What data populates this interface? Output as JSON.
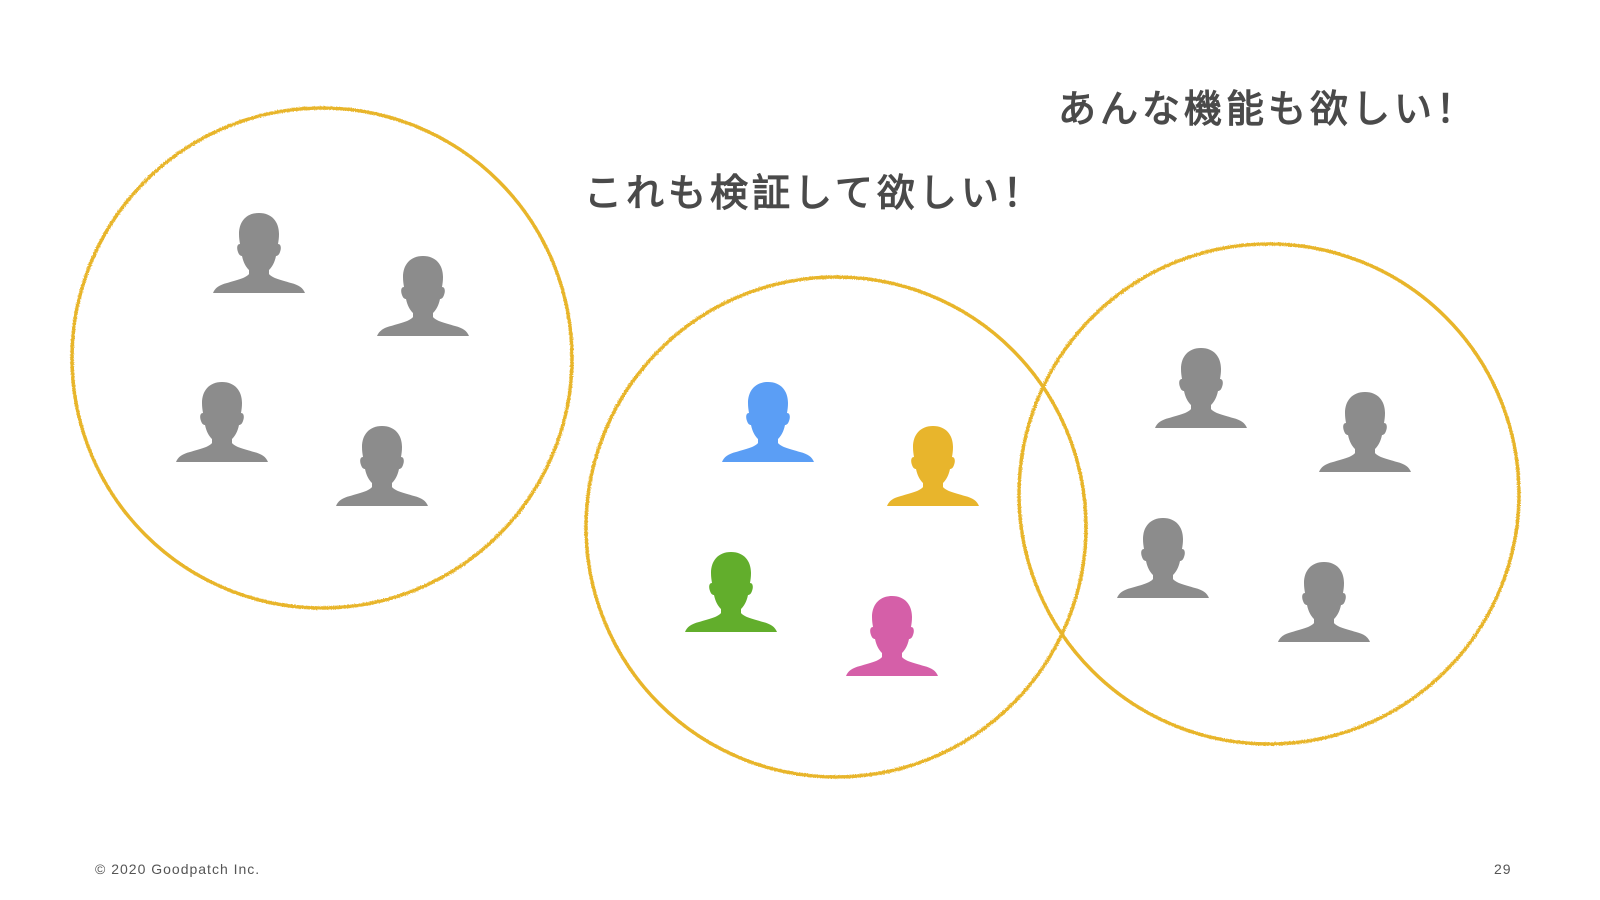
{
  "callouts": {
    "right": "あんな機能も欲しい！",
    "middle": "これも検証して欲しい！"
  },
  "footer": {
    "copyright": "© 2020 Goodpatch Inc.",
    "page_number": "29"
  },
  "colors": {
    "circle_stroke": "#E8B52C",
    "person_gray": "#8C8C8C",
    "person_blue": "#5B9EF5",
    "person_yellow": "#E8B52C",
    "person_green": "#62AE2C",
    "person_pink": "#D55FA8",
    "text": "#4A4A4A"
  },
  "groups": [
    {
      "id": "left-group",
      "icons": [
        "person-icon",
        "person-icon",
        "person-icon",
        "person-icon"
      ],
      "people_colors": [
        "gray",
        "gray",
        "gray",
        "gray"
      ]
    },
    {
      "id": "middle-group",
      "icons": [
        "person-icon",
        "person-icon",
        "person-icon",
        "person-icon"
      ],
      "people_colors": [
        "blue",
        "yellow",
        "green",
        "pink"
      ]
    },
    {
      "id": "right-group",
      "icons": [
        "person-icon",
        "person-icon",
        "person-icon",
        "person-icon"
      ],
      "people_colors": [
        "gray",
        "gray",
        "gray",
        "gray"
      ]
    }
  ]
}
